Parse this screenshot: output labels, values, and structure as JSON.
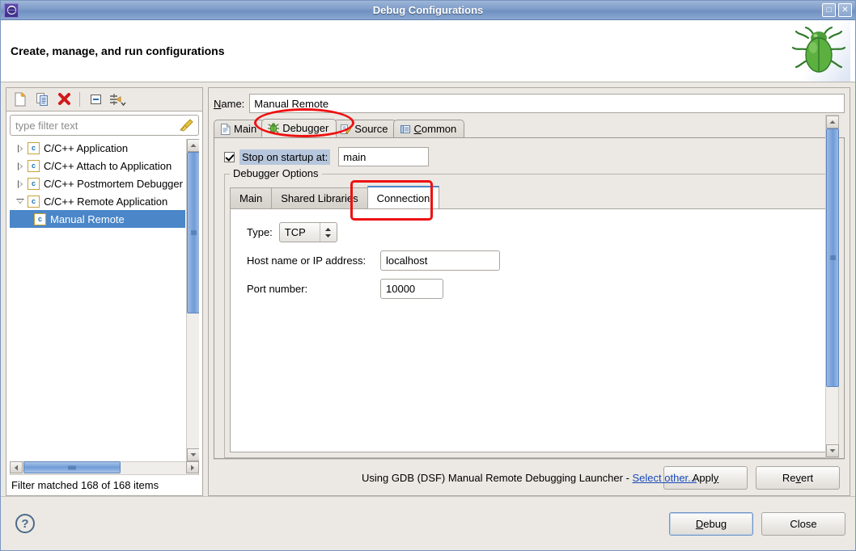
{
  "window": {
    "title": "Debug Configurations",
    "app_icon": "eclipse-icon",
    "maximize_label": "□",
    "close_label": "✕"
  },
  "header": {
    "title": "Create, manage, and run configurations",
    "banner_icon": "green-bug-icon"
  },
  "sidebar": {
    "toolbar": [
      {
        "name": "new-configuration-icon",
        "label": "New"
      },
      {
        "name": "duplicate-configuration-icon",
        "label": "Duplicate"
      },
      {
        "name": "delete-configuration-icon",
        "label": "Delete"
      },
      {
        "name": "collapse-all-icon",
        "label": "Collapse All"
      },
      {
        "name": "filter-menu-icon",
        "label": "Filter"
      }
    ],
    "filter": {
      "placeholder": "type filter text",
      "value": "",
      "clear_icon": "broom-icon"
    },
    "tree": [
      {
        "label": "C/C++ Application",
        "expanded": false,
        "selected": false,
        "child": false
      },
      {
        "label": "C/C++ Attach to Application",
        "expanded": false,
        "selected": false,
        "child": false
      },
      {
        "label": "C/C++ Postmortem Debugger",
        "expanded": false,
        "selected": false,
        "child": false
      },
      {
        "label": "C/C++ Remote Application",
        "expanded": true,
        "selected": false,
        "child": false
      },
      {
        "label": "Manual Remote",
        "expanded": null,
        "selected": true,
        "child": true
      }
    ],
    "status": "Filter matched 168 of 168 items"
  },
  "main": {
    "name_label": "Name:",
    "name_label_mnemonic": "N",
    "name_value": "Manual Remote",
    "tabs": [
      {
        "label": "Main",
        "icon": "document-icon",
        "active": false,
        "mnemonic": ""
      },
      {
        "label": "Debugger",
        "icon": "bug-icon",
        "active": true,
        "mnemonic": ""
      },
      {
        "label": "Source",
        "icon": "source-icon",
        "active": false,
        "mnemonic": ""
      },
      {
        "label": "Common",
        "icon": "common-icon",
        "active": false,
        "mnemonic": "C"
      }
    ],
    "stop_on_startup": {
      "checked": true,
      "label": "Stop on startup at:",
      "value": "main"
    },
    "group_title": "Debugger Options",
    "inner_tabs": [
      {
        "label": "Main",
        "active": false
      },
      {
        "label": "Shared Libraries",
        "active": false
      },
      {
        "label": "Connection",
        "active": true
      }
    ],
    "connection": {
      "type_label": "Type:",
      "type_value": "TCP",
      "host_label": "Host name or IP address:",
      "host_value": "localhost",
      "port_label": "Port number:",
      "port_value": "10000"
    }
  },
  "footer": {
    "using_prefix": "Using GDB (DSF) Manual Remote Debugging Launcher - ",
    "select_other_link": "Select other...",
    "apply_label": "Apply",
    "apply_mnemonic": "y",
    "revert_label": "Revert",
    "revert_mnemonic": "v",
    "help_icon": "help-question-icon",
    "debug_label": "Debug",
    "debug_mnemonic": "D",
    "close_label": "Close"
  },
  "annotations": {
    "debugger_tab_highlight": "red-oval",
    "connection_tab_highlight": "red-rounded-rect"
  },
  "colors": {
    "titlebar": "#7e9cc8",
    "selection": "#4a86c8",
    "accent_tab": "#4a86c8",
    "link": "#1a49b8",
    "annotation": "#ee1111",
    "label_highlight": "#b6c6dc",
    "panel": "#ece9e4"
  }
}
